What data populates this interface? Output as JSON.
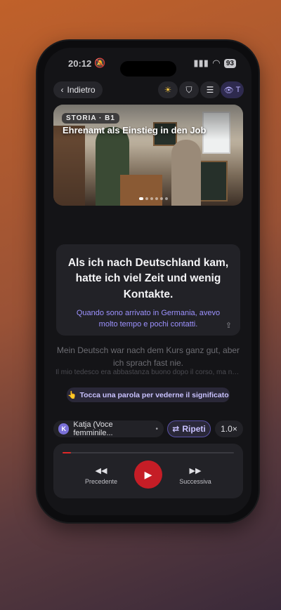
{
  "status": {
    "time": "20:12",
    "bell": "bell-slash-icon",
    "battery": "93"
  },
  "header": {
    "back_label": "Indietro",
    "theme_icon": "sun-icon",
    "bookmark_icon": "bookmark-icon",
    "list_icon": "list-icon",
    "translation_label": "T"
  },
  "hero": {
    "tag": "STORIA · B1",
    "title": "Ehrenamt als Einstieg in den Job"
  },
  "sentence": {
    "german": "Als ich nach Deutschland kam, hatte ich viel Zeit und wenig Kontakte.",
    "italian": "Quando sono arrivato in Germania, avevo molto tempo e pochi contatti."
  },
  "next_sentence": {
    "german": "Mein Deutsch war nach dem Kurs ganz gut, aber ich sprach fast nie.",
    "italian": "Il mio tedesco era abbastanza buono dopo il corso, ma non..."
  },
  "hint": {
    "icon": "👆",
    "text": "Tocca una parola per vederne il significato"
  },
  "voice": {
    "initial": "K",
    "label": "Katja (Voce femminile..."
  },
  "repeat": {
    "label": "Ripeti"
  },
  "speed": {
    "label": "1.0×"
  },
  "player": {
    "progress": 0.05,
    "prev_label": "Precedente",
    "next_label": "Successiva",
    "accent": "#c51d26"
  }
}
